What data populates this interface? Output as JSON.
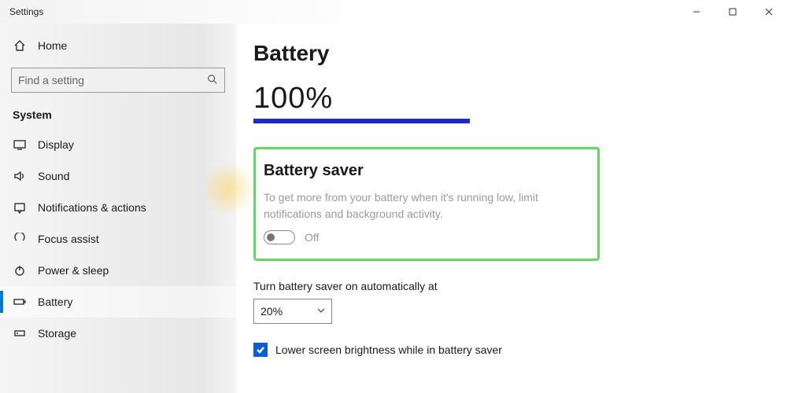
{
  "window": {
    "title": "Settings"
  },
  "sidebar": {
    "home": "Home",
    "search_placeholder": "Find a setting",
    "category": "System",
    "items": [
      {
        "label": "Display"
      },
      {
        "label": "Sound"
      },
      {
        "label": "Notifications & actions"
      },
      {
        "label": "Focus assist"
      },
      {
        "label": "Power & sleep"
      },
      {
        "label": "Battery"
      },
      {
        "label": "Storage"
      }
    ]
  },
  "page": {
    "title": "Battery",
    "level": "100%",
    "saver": {
      "heading": "Battery saver",
      "description": "To get more from your battery when it's running low, limit notifications and background activity.",
      "toggle_state": "Off"
    },
    "auto": {
      "label": "Turn battery saver on automatically at",
      "value": "20%"
    },
    "brightness_checkbox": "Lower screen brightness while in battery saver"
  }
}
